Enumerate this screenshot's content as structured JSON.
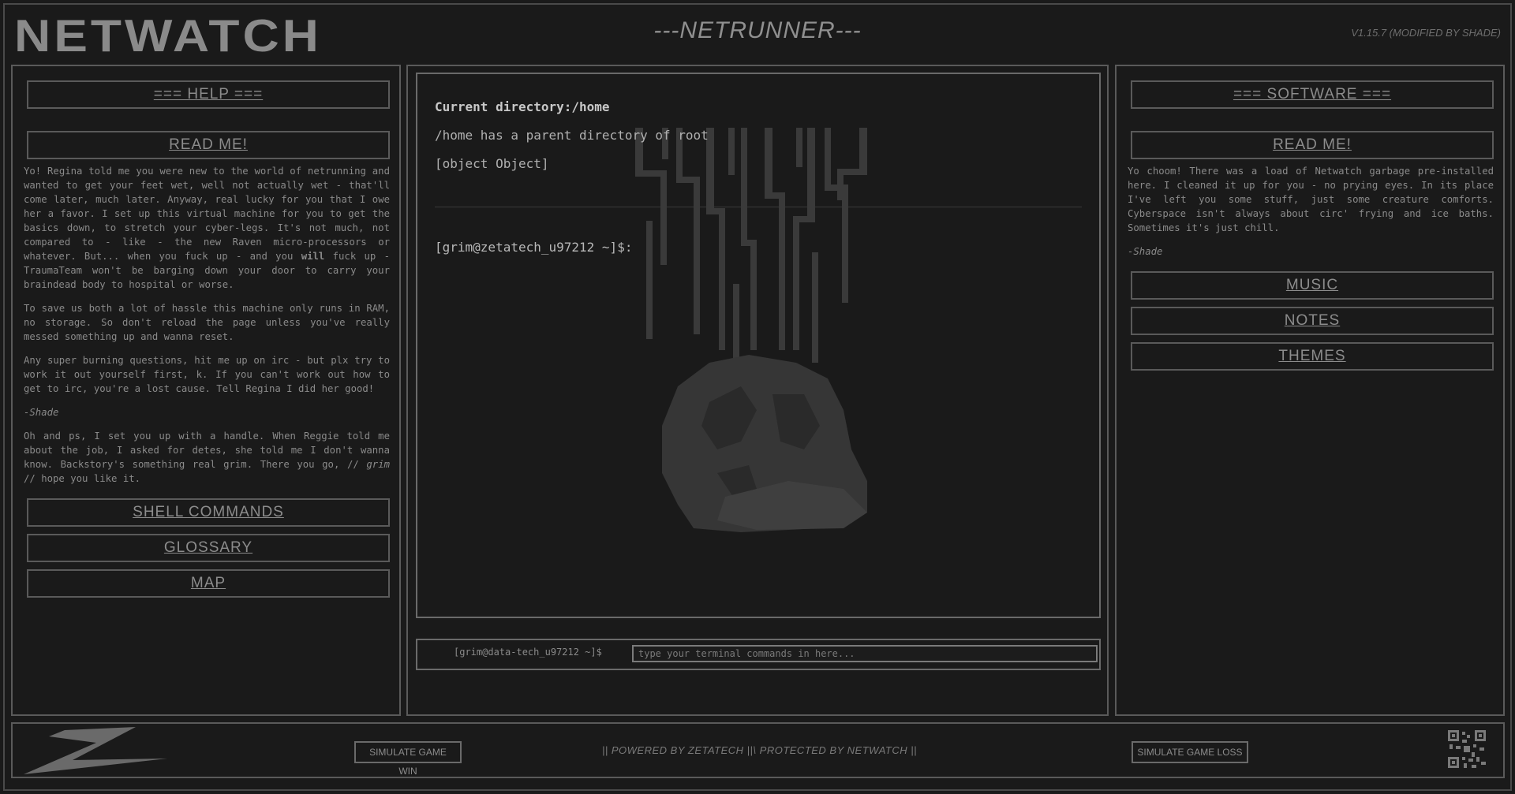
{
  "header": {
    "logo": "NETWATCH",
    "title": "---NETRUNNER---",
    "version": "V1.15.7 (MODIFIED BY SHADE)"
  },
  "left_panel": {
    "help_heading": "=== HELP ===",
    "readme_label": "READ ME!",
    "paragraphs": [
      "Yo! Regina told me you were new to the world of netrunning and wanted to get your feet wet, well not actually wet - that'll come later, much later. Anyway, real lucky for you that I owe her a favor. I set up this virtual machine for you to get the basics down, to stretch your cyber-legs. It's not much, not compared to - like - the new Raven micro-processors or whatever. But... when you fuck up - and you",
      "will",
      "fuck up - TraumaTeam won't be barging down your door to carry your braindead body to hospital or worse.",
      "To save us both a lot of hassle this machine only runs in RAM, no storage. So don't reload the page unless you've really messed something up and wanna reset.",
      "Any super burning questions, hit me up on irc - but plx try to work it out yourself first, k. If you can't work out how to get to irc, you're a lost cause. Tell Regina I did her good!",
      "-Shade",
      "Oh and ps, I set you up with a handle. When Reggie told me about the job, I asked for detes, she told me I don't wanna know. Backstory's something real grim. There you go, //",
      "grim",
      "// hope you like it."
    ],
    "buttons": [
      "SHELL COMMANDS",
      "GLOSSARY",
      "MAP"
    ]
  },
  "right_panel": {
    "software_heading": "=== SOFTWARE ===",
    "readme_label": "READ ME!",
    "paragraph": "Yo choom! There was a load of Netwatch garbage pre-installed here. I cleaned it up for you - no prying eyes. In its place I've left you some stuff, just some creature comforts. Cyberspace isn't always about circ' frying and ice baths. Sometimes it's just chill.",
    "signature": "-Shade",
    "buttons": [
      "MUSIC",
      "NOTES",
      "THEMES"
    ]
  },
  "terminal": {
    "line1": "Current directory:/home",
    "line2": "/home has a parent directory of root",
    "line3": "[object Object]",
    "prompt": "[grim@zetatech_u97212 ~]$:",
    "input_prompt": "[grim@data-tech_u97212 ~]$",
    "input_placeholder": "type your terminal commands in here..."
  },
  "footer": {
    "win_button": "SIMULATE GAME WIN",
    "center_text": "|| POWERED BY ZETATECH ||\\ PROTECTED BY NETWATCH ||",
    "loss_button": "SIMULATE GAME LOSS"
  }
}
